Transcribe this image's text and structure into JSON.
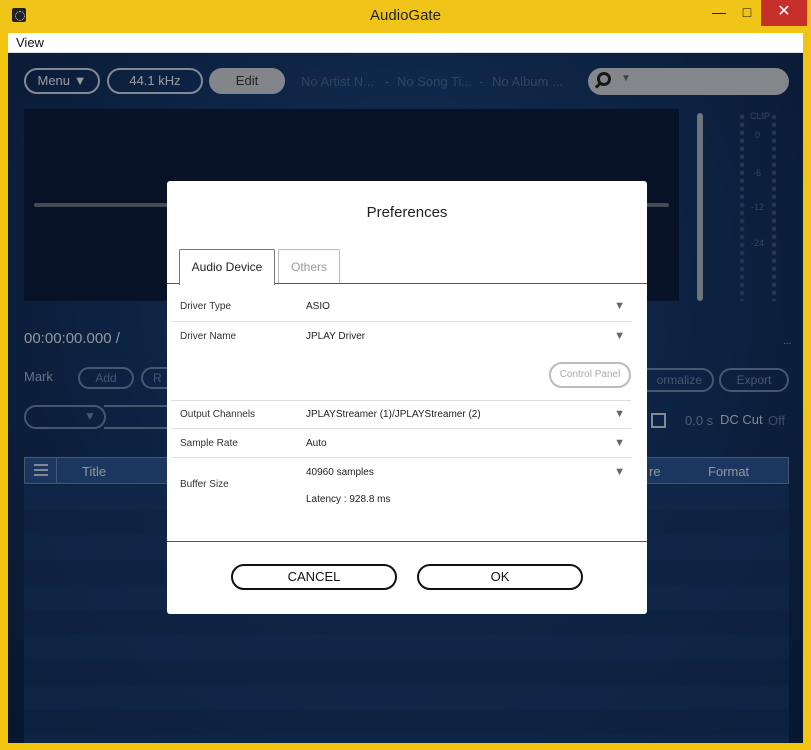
{
  "window": {
    "title": "AudioGate",
    "minimize": "—",
    "maximize": "□",
    "close": "✕"
  },
  "menubar": {
    "view": "View"
  },
  "toolbar": {
    "menu_label": "Menu ▼",
    "sample_rate": "44.1 kHz",
    "edit_label": "Edit",
    "artist": "No Artist N...",
    "sep1": "-",
    "song": "No Song Ti...",
    "sep2": "-",
    "album": "No Album ..."
  },
  "meter": {
    "clip": "CLIP",
    "ticks": [
      "0",
      "-6",
      "-12",
      "-24"
    ]
  },
  "transport": {
    "timecode": "00:00:00.000 /",
    "ellipsis": "..."
  },
  "mark": {
    "label": "Mark",
    "add": "Add",
    "r": "R",
    "normalize": "ormalize",
    "export": "Export"
  },
  "dc": {
    "time": "0.0 s",
    "label": "DC Cut",
    "state": "Off"
  },
  "table": {
    "headers": {
      "title": "Title",
      "re": "re",
      "format": "Format"
    }
  },
  "dialog": {
    "title": "Preferences",
    "tabs": {
      "audio_device": "Audio Device",
      "others": "Others"
    },
    "rows": {
      "driver_type": {
        "label": "Driver Type",
        "value": "ASIO"
      },
      "driver_name": {
        "label": "Driver Name",
        "value": "JPLAY Driver"
      },
      "output_channels": {
        "label": "Output Channels",
        "value": "JPLAYStreamer (1)/JPLAYStreamer (2)"
      },
      "sample_rate": {
        "label": "Sample Rate",
        "value": "Auto"
      },
      "buffer_size": {
        "label": "Buffer Size",
        "value": "40960 samples"
      }
    },
    "control_panel": "Control Panel",
    "latency": "Latency : 928.8 ms",
    "cancel": "CANCEL",
    "ok": "OK",
    "caret": "▼"
  }
}
